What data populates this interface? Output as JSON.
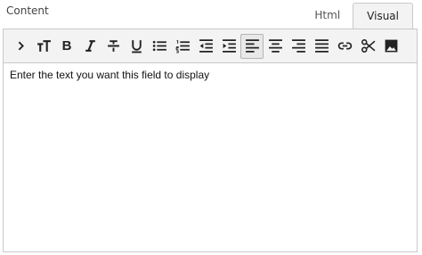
{
  "field": {
    "label": "Content"
  },
  "tabs": [
    {
      "label": "Html",
      "active": false
    },
    {
      "label": "Visual",
      "active": true
    }
  ],
  "toolbar": {
    "buttons": [
      "chevron-right-icon",
      "text-size-icon",
      "bold-icon",
      "italic-icon",
      "strikethrough-icon",
      "underline-icon",
      "bulleted-list-icon",
      "numbered-list-icon",
      "outdent-icon",
      "indent-icon",
      "align-left-icon",
      "align-center-icon",
      "align-right-icon",
      "justify-icon",
      "link-icon",
      "cut-icon",
      "image-icon"
    ],
    "bold_glyph": "B"
  },
  "editor": {
    "text": "Enter the text you want this field to display"
  },
  "colors": {
    "toolbar_bg": "#f3f3f3",
    "border": "#c9c9c9",
    "icon": "#222222"
  }
}
